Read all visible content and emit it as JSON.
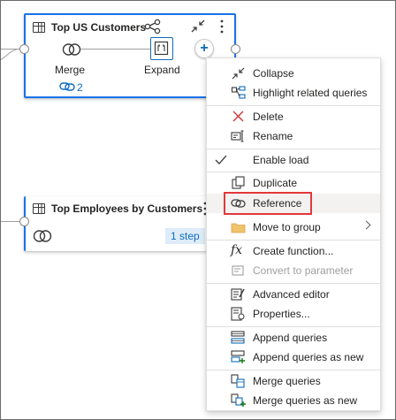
{
  "cards": {
    "top_us": {
      "title": "Top US Customers",
      "steps": {
        "merge_label": "Merge",
        "expand_label": "Expand"
      },
      "link_count": "2"
    },
    "top_employees": {
      "title": "Top Employees by Customers",
      "step_badge": "1 step"
    }
  },
  "menu": {
    "collapse": "Collapse",
    "highlight": "Highlight related queries",
    "delete": "Delete",
    "rename": "Rename",
    "enable_load": "Enable load",
    "duplicate": "Duplicate",
    "reference": "Reference",
    "move_to_group": "Move to group",
    "create_function": "Create function...",
    "convert_param": "Convert to parameter",
    "advanced_editor": "Advanced editor",
    "properties": "Properties...",
    "append": "Append queries",
    "append_new": "Append queries as new",
    "merge": "Merge queries",
    "merge_new": "Merge queries as new"
  },
  "colors": {
    "accent": "#0f6cbd",
    "selection": "#1a73e8",
    "highlight_box": "#e3383b",
    "delete": "#d13438"
  },
  "icons": [
    "table-icon",
    "share-icon",
    "collapse-icon",
    "more-icon",
    "merge-icon",
    "expand-icon",
    "link-icon",
    "add-icon",
    "highlight-icon",
    "delete-icon",
    "rename-icon",
    "check-icon",
    "duplicate-icon",
    "reference-icon",
    "folder-icon",
    "function-icon",
    "convert-icon",
    "advanced-editor-icon",
    "properties-icon",
    "append-icon",
    "append-new-icon",
    "merge-queries-icon",
    "merge-new-icon"
  ]
}
